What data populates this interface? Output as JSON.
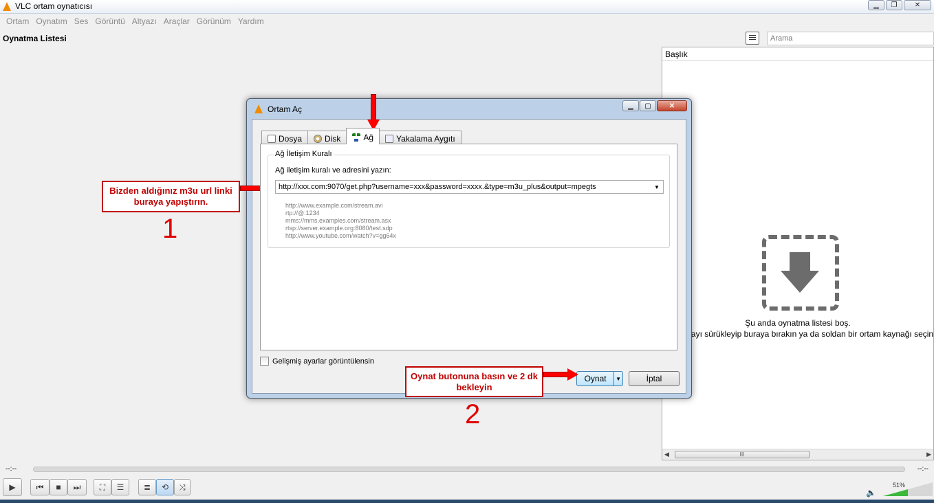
{
  "window": {
    "title": "VLC ortam oynatıcısı",
    "minimize": "▁",
    "maximize": "❐",
    "close": "✕"
  },
  "menu": [
    "Ortam",
    "Oynatım",
    "Ses",
    "Görüntü",
    "Altyazı",
    "Araçlar",
    "Görünüm",
    "Yardım"
  ],
  "playlist": {
    "header": "Oynatma Listesi",
    "search_placeholder": "Arama",
    "column_title": "Başlık",
    "empty_line1": "Şu anda oynatma listesi boş.",
    "empty_line2": "Dosyayı sürükleyip buraya bırakın ya da soldan bir ortam kaynağı seçin.",
    "scroll_grip": "III"
  },
  "controls": {
    "time_elapsed": "--:--",
    "time_total": "--:--",
    "volume_label": "51%",
    "volume_level": 0.51,
    "shuffle_active": false,
    "loop_active": true
  },
  "dialog": {
    "title": "Ortam Aç",
    "tabs": [
      {
        "label": "Dosya",
        "icon": "file-icon"
      },
      {
        "label": "Disk",
        "icon": "disc-icon"
      },
      {
        "label": "Ağ",
        "icon": "network-icon"
      },
      {
        "label": "Yakalama Aygıtı",
        "icon": "capture-device-icon"
      }
    ],
    "selected_tab": 2,
    "group_title": "Ağ İletişim Kuralı",
    "field_label": "Ağ iletişim kuralı ve adresini yazın:",
    "url_value": "http://xxx.com:9070/get.php?username=xxx&password=xxxx.&type=m3u_plus&output=mpegts",
    "examples": [
      "http://www.example.com/stream.avi",
      "rtp://@:1234",
      "mms://mms.examples.com/stream.asx",
      "rtsp://server.example.org:8080/test.sdp",
      "http://www.youtube.com/watch?v=gg64x"
    ],
    "advanced_checkbox": "Gelişmiş ayarlar görüntülensin",
    "advanced_checked": false,
    "play_button": "Oynat",
    "cancel_button": "İptal"
  },
  "annotations": {
    "note1": "Bizden aldığınız m3u url linki buraya yapıştırın.",
    "num1": "1",
    "note2": "Oynat butonuna basın ve 2 dk bekleyin",
    "num2": "2",
    "arrow_color": "#ff0000"
  }
}
